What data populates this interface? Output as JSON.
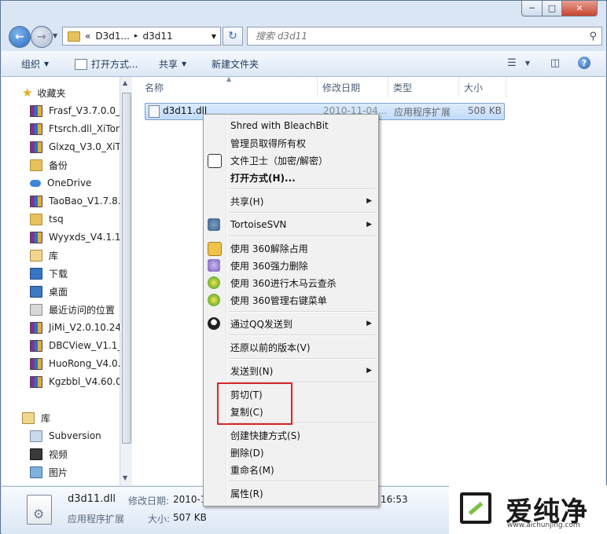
{
  "window": {
    "controls": {
      "minimize": "─",
      "maximize": "□",
      "close": "✕"
    }
  },
  "nav": {
    "back_icon": "arrow-left-icon",
    "forward_icon": "arrow-right-icon",
    "breadcrumb": [
      "«",
      "D3d1...",
      "▸",
      "d3d11"
    ],
    "search_placeholder": "搜索 d3d11"
  },
  "toolbar": {
    "organize": "组织",
    "open_with": "打开方式...",
    "share": "共享",
    "new_folder": "新建文件夹"
  },
  "sidebar": {
    "favorites_label": "收藏夹",
    "items": [
      {
        "label": "Frasf_V3.7.0.0_X",
        "icon": "rar-icon"
      },
      {
        "label": "Ftsrch.dll_XiTon",
        "icon": "rar-icon"
      },
      {
        "label": "Glxzq_V3.0_XiTo",
        "icon": "rar-icon"
      },
      {
        "label": "备份",
        "icon": "folder-icon"
      },
      {
        "label": "OneDrive",
        "icon": "cloud-icon"
      },
      {
        "label": "TaoBao_V1.7.8.",
        "icon": "rar-icon"
      },
      {
        "label": "tsq",
        "icon": "folder-icon"
      },
      {
        "label": "Wyyxds_V4.1.1.",
        "icon": "rar-icon"
      },
      {
        "label": "库",
        "icon": "library-icon"
      },
      {
        "label": "下载",
        "icon": "download-icon"
      },
      {
        "label": "桌面",
        "icon": "desktop-icon"
      },
      {
        "label": "最近访问的位置",
        "icon": "recent-icon"
      },
      {
        "label": "JiMi_V2.0.10.24_",
        "icon": "rar-icon"
      },
      {
        "label": "DBCView_V1.1_",
        "icon": "rar-icon"
      },
      {
        "label": "HuoRong_V4.0.",
        "icon": "rar-icon"
      },
      {
        "label": "Kgzbbl_V4.60.0",
        "icon": "rar-icon"
      }
    ],
    "library_label": "库",
    "library_items": [
      {
        "label": "Subversion",
        "icon": "svn-icon"
      },
      {
        "label": "视频",
        "icon": "video-icon"
      },
      {
        "label": "图片",
        "icon": "picture-icon"
      }
    ]
  },
  "columns": {
    "name": "名称",
    "modified": "修改日期",
    "type": "类型",
    "size": "大小"
  },
  "file": {
    "name": "d3d11.dll",
    "modified": "2010-11-04...",
    "type": "应用程序扩展",
    "size": "508 KB"
  },
  "context_menu": {
    "items": [
      {
        "label": "Shred with BleachBit"
      },
      {
        "label": "管理员取得所有权"
      },
      {
        "label": "文件卫士（加密/解密）"
      },
      {
        "label": "打开方式(H)..."
      },
      {
        "label": "共享(H)"
      },
      {
        "label": "TortoiseSVN"
      },
      {
        "label": "使用 360解除占用"
      },
      {
        "label": "使用 360强力删除"
      },
      {
        "label": "使用 360进行木马云查杀"
      },
      {
        "label": "使用 360管理右键菜单"
      },
      {
        "label": "通过QQ发送到"
      },
      {
        "label": "还原以前的版本(V)"
      },
      {
        "label": "发送到(N)"
      },
      {
        "label": "剪切(T)"
      },
      {
        "label": "复制(C)"
      },
      {
        "label": "创建快捷方式(S)"
      },
      {
        "label": "删除(D)"
      },
      {
        "label": "重命名(M)"
      },
      {
        "label": "属性(R)"
      }
    ],
    "submenu_arrow": "▶",
    "highlight_color": "#d6262c"
  },
  "details": {
    "name": "d3d11.dll",
    "modified_label": "修改日期:",
    "modified_value": "2010-1",
    "modified_time": "16:53",
    "type": "应用程序扩展",
    "size_label": "大小:",
    "size_value": "507 KB"
  },
  "watermark": {
    "brand": "爱纯净",
    "url": "www.aichunjing.com"
  },
  "colors": {
    "accent": "#2a6bc0",
    "selection": "#c1dcfb",
    "frame": "#dbe6f4"
  }
}
